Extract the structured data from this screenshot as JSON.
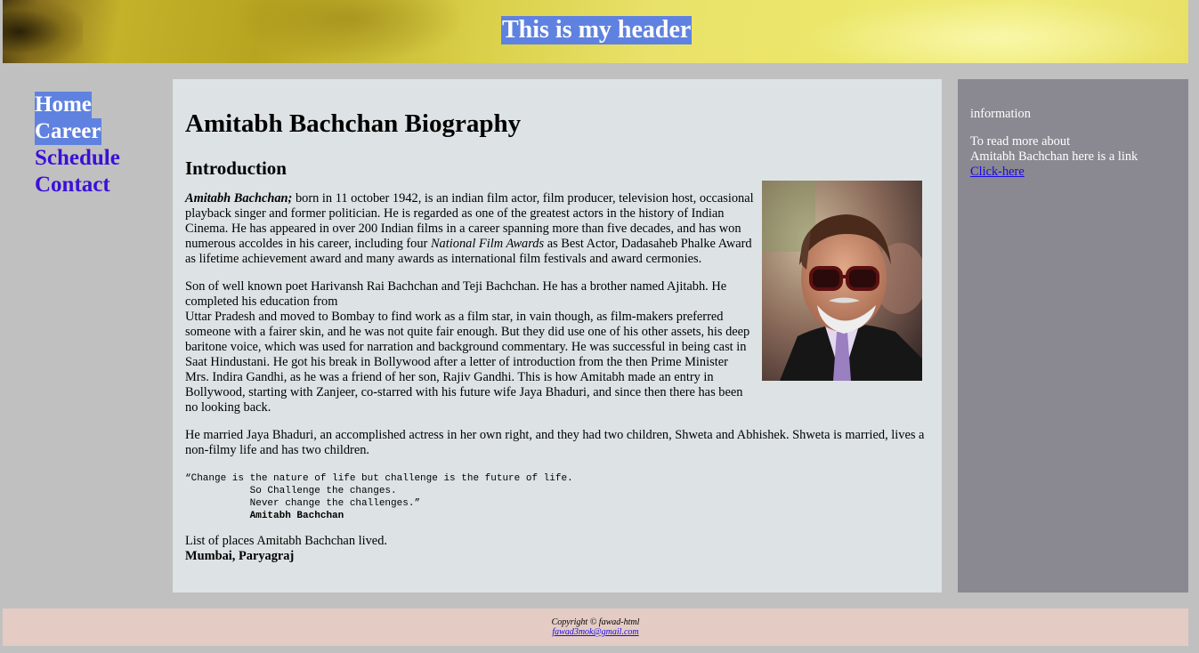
{
  "header": {
    "title": "This is my header"
  },
  "nav": {
    "items": [
      "Home",
      "Career",
      "Schedule",
      "Contact"
    ]
  },
  "main": {
    "title": "Amitabh Bachchan Biography",
    "section_title": "Introduction",
    "p1_name": "Amitabh Bachchan;",
    "p1_a": " born in 11 october 1942, is an indian film actor, film producer, television host, occasional playback singer and former politician. He is regarded as one of the greatest actors in the history of Indian Cinema. He has appeared in over 200 Indian films in a career spanning more than five decades, and has won numerous accoldes in his career, including four ",
    "p1_award": "National Film Awards",
    "p1_b": " as Best Actor, Dadasaheb Phalke Award as lifetime achievement award and many awards as international film festivals and award cermonies.",
    "p2_a": "Son of well known poet Harivansh Rai Bachchan and Teji Bachchan. He has a brother named Ajitabh. He completed his education from",
    "p2_b": "Uttar Pradesh and moved to Bombay to find work as a film star, in vain though, as film-makers preferred someone with a fairer skin, and he was not quite fair enough. But they did use one of his other assets, his deep baritone voice, which was used for narration and background commentary. He was successful in being cast in Saat Hindustani. He got his break in Bollywood after a letter of introduction from the then Prime Minister Mrs. Indira Gandhi, as he was a friend of her son, Rajiv Gandhi. This is how Amitabh made an entry in Bollywood, starting with Zanjeer, co-starred with his future wife Jaya Bhaduri, and since then there has been no looking back.",
    "p3": "He married Jaya Bhaduri, an accomplished actress in her own right, and they had two children, Shweta and Abhishek. Shweta is married, lives a non-filmy life and has two children.",
    "quote_1": "“Change is the nature of life but challenge is the future of life.",
    "quote_2": "           So Challenge the changes.",
    "quote_3": "           Never change the challenges.”",
    "quote_author": "Amitabh Bachchan",
    "list_intro": "List of places Amitabh Bachchan lived.",
    "list_places": "Mumbai, Paryagraj"
  },
  "aside": {
    "heading": "information",
    "text_1": "To read more about",
    "text_2": "Amitabh Bachchan here is a link",
    "link": "Click-here"
  },
  "footer": {
    "copyright": "Copyright © fawad-html",
    "email": "fawad3mok@gmail.com"
  }
}
